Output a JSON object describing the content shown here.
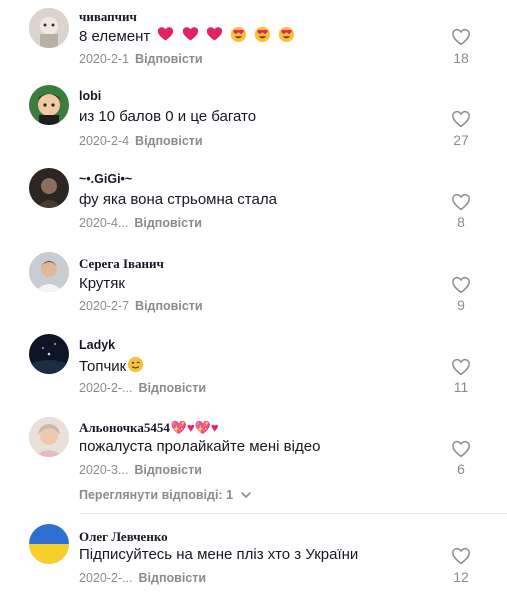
{
  "reply_label": "Відповісти",
  "like_icon": "heart-outline-icon",
  "comments": [
    {
      "username": "чивапчич",
      "text": "8 елемент",
      "date": "2020-2-1",
      "likes": "18",
      "emojis": [
        "red-heart",
        "red-heart",
        "red-heart",
        "heart-eyes",
        "heart-eyes",
        "heart-eyes"
      ]
    },
    {
      "username": "lobi",
      "text": "из 10 балов 0 и це багато",
      "date": "2020-2-4",
      "likes": "27"
    },
    {
      "username": "~•.GiGi•~",
      "text": "фу яка вона стрьомна стала",
      "date": "2020-4...",
      "likes": "8"
    },
    {
      "username": "Серега Іванич",
      "text": "Крутяк",
      "date": "2020-2-7",
      "likes": "9"
    },
    {
      "username": "Ladyk",
      "text": "Топчик",
      "date": "2020-2-...",
      "likes": "11",
      "emojis": [
        "winking-face"
      ]
    },
    {
      "username": "Альоночка5454",
      "username_emojis": "💖♥💖♥",
      "text": "пожалуста пролайкайте мені відео",
      "date": "2020-3...",
      "likes": "6",
      "view_replies": "Переглянути відповіді: 1"
    },
    {
      "username": "Олег Левченко",
      "text": "Підписуйтесь на мене пліз хто з України",
      "date": "2020-2-...",
      "likes": "12"
    }
  ],
  "colors": {
    "text": "#161823",
    "muted": "#8a8b91",
    "heart_red": "#e0245e"
  }
}
